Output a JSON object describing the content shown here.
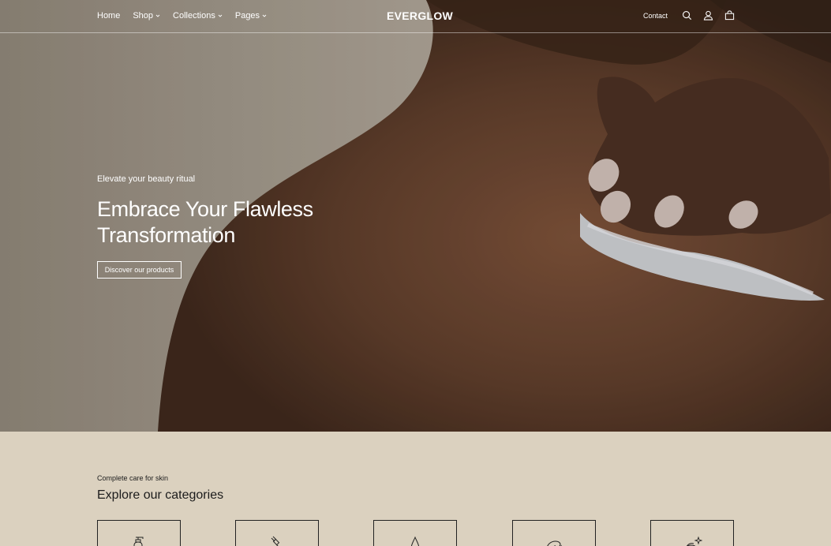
{
  "header": {
    "nav": [
      {
        "label": "Home",
        "has_dropdown": false
      },
      {
        "label": "Shop",
        "has_dropdown": true
      },
      {
        "label": "Collections",
        "has_dropdown": true
      },
      {
        "label": "Pages",
        "has_dropdown": true
      }
    ],
    "logo": "EVERGLOW",
    "contact": "Contact",
    "icons": [
      "search-icon",
      "account-icon",
      "cart-icon"
    ]
  },
  "hero": {
    "eyebrow": "Elevate your beauty ritual",
    "title": "Embrace Your Flawless Transformation",
    "cta": "Discover our products"
  },
  "categories": {
    "eyebrow": "Complete care for skin",
    "title": "Explore our categories",
    "items": [
      {
        "icon": "pump-bottle-icon"
      },
      {
        "icon": "dropper-icon"
      },
      {
        "icon": "drop-icon"
      },
      {
        "icon": "cream-swirl-icon"
      },
      {
        "icon": "sparkle-jar-icon"
      }
    ]
  },
  "colors": {
    "section_bg": "#dbd1bf",
    "text_dark": "#1c1c1c",
    "text_light": "#ffffff"
  }
}
